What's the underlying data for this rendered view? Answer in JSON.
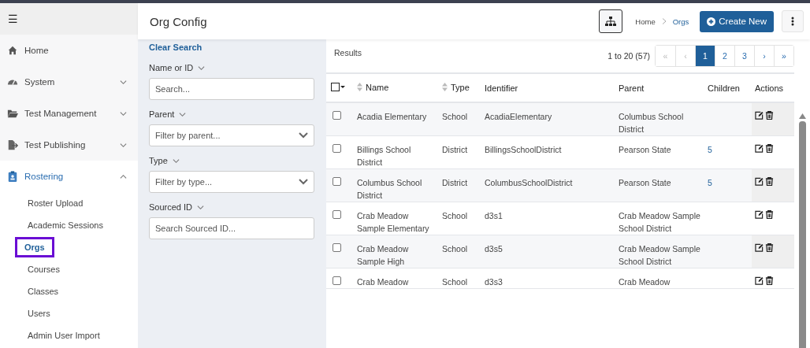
{
  "sidebar": {
    "menu_icon": "☰",
    "items": [
      {
        "label": "Home",
        "kind": "link",
        "selected": false
      },
      {
        "label": "System",
        "kind": "group",
        "selected": false,
        "expanded": false
      },
      {
        "label": "Test Management",
        "kind": "group",
        "selected": false,
        "expanded": false
      },
      {
        "label": "Test Publishing",
        "kind": "group",
        "selected": false,
        "expanded": false
      },
      {
        "label": "Rostering",
        "kind": "group",
        "selected": true,
        "expanded": true,
        "children": [
          {
            "label": "Roster Upload",
            "selected": false
          },
          {
            "label": "Academic Sessions",
            "selected": false
          },
          {
            "label": "Orgs",
            "selected": true
          },
          {
            "label": "Courses",
            "selected": false
          },
          {
            "label": "Classes",
            "selected": false
          },
          {
            "label": "Users",
            "selected": false
          },
          {
            "label": "Admin User Import",
            "selected": false
          }
        ]
      }
    ]
  },
  "header": {
    "title": "Org Config",
    "breadcrumb": [
      "Home",
      "Orgs"
    ],
    "create_button": "Create New"
  },
  "filters": {
    "clear_link": "Clear Search",
    "fields": [
      {
        "label": "Name or ID",
        "kind": "text",
        "placeholder": "Search..."
      },
      {
        "label": "Parent",
        "kind": "select",
        "placeholder": "Filter by parent..."
      },
      {
        "label": "Type",
        "kind": "select",
        "placeholder": "Filter by type..."
      },
      {
        "label": "Sourced ID",
        "kind": "text",
        "placeholder": "Search Sourced ID..."
      }
    ]
  },
  "results": {
    "label": "Results",
    "range": "1 to 20 (57)",
    "pages": [
      {
        "label": "«",
        "selected": false,
        "disabled": true
      },
      {
        "label": "‹",
        "selected": false,
        "disabled": true
      },
      {
        "label": "1",
        "selected": true,
        "disabled": false
      },
      {
        "label": "2",
        "selected": false,
        "disabled": false
      },
      {
        "label": "3",
        "selected": false,
        "disabled": false
      },
      {
        "label": "›",
        "selected": false,
        "disabled": false
      },
      {
        "label": "»",
        "selected": false,
        "disabled": false
      }
    ]
  },
  "table": {
    "select_all_checked": false,
    "columns": [
      {
        "label": "Name",
        "sortable": true
      },
      {
        "label": "Type",
        "sortable": true
      },
      {
        "label": "Identifier",
        "sortable": false
      },
      {
        "label": "Parent",
        "sortable": false
      },
      {
        "label": "Children",
        "sortable": false
      },
      {
        "label": "Actions",
        "sortable": false
      }
    ],
    "rows": [
      {
        "checked": false,
        "name": "Acadia Elementary",
        "type": "School",
        "identifier": "AcadiaElementary",
        "parent": "Columbus School District"
      },
      {
        "checked": false,
        "name": "Billings School District",
        "type": "District",
        "identifier": "BillingsSchoolDistrict",
        "parent": "Pearson State",
        "children": "5"
      },
      {
        "checked": false,
        "name": "Columbus School District",
        "type": "District",
        "identifier": "ColumbusSchoolDistrict",
        "parent": "Pearson State",
        "children": "5"
      },
      {
        "checked": false,
        "name": "Crab Meadow Sample Elementary",
        "type": "School",
        "identifier": "d3s1",
        "parent": "Crab Meadow Sample School District"
      },
      {
        "checked": false,
        "name": "Crab Meadow Sample High",
        "type": "School",
        "identifier": "d3s5",
        "parent": "Crab Meadow Sample School District"
      },
      {
        "checked": false,
        "name": "Crab Meadow",
        "type": "School",
        "identifier": "d3s3",
        "parent": "Crab Meadow"
      }
    ]
  }
}
